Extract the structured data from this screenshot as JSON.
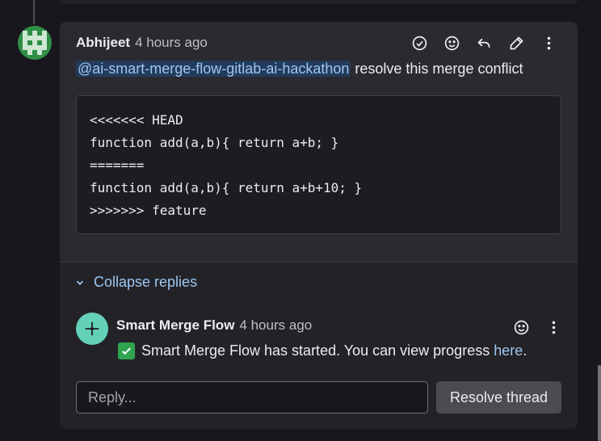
{
  "note": {
    "author": "Abhijeet",
    "time": "4 hours ago",
    "mention": "@ai-smart-merge-flow-gitlab-ai-hackathon",
    "text": " resolve this merge conflict",
    "code_lines": [
      "<<<<<<< HEAD",
      "function add(a,b){ return a+b; }",
      "=======",
      "function add(a,b){ return a+b+10; }",
      ">>>>>>> feature"
    ],
    "action_icons": [
      "resolve-check-icon",
      "emoji-reaction-icon",
      "reply-arrow-icon",
      "edit-pencil-icon",
      "more-vertical-icon"
    ]
  },
  "replies": {
    "collapse_label": "Collapse replies",
    "reply": {
      "author": "Smart Merge Flow",
      "time": "4 hours ago",
      "message": "Smart Merge Flow has started. You can view progress ",
      "link_text": "here",
      "trailing": "."
    },
    "input_placeholder": "Reply...",
    "resolve_label": "Resolve thread"
  },
  "colors": {
    "accent_link": "#9dc7f1",
    "mention_bg": "#243b5c",
    "avatar_green": "#2f8f46",
    "bot_avatar": "#63d1b8",
    "check_green": "#2ea44f"
  }
}
